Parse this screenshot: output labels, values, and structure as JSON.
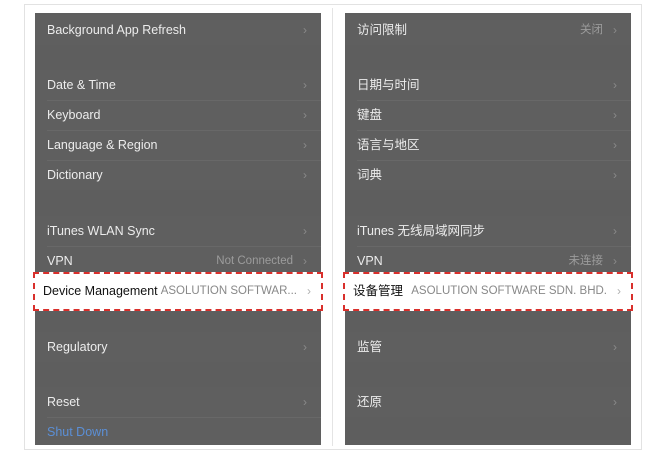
{
  "left": {
    "rows": [
      {
        "label": "Background App Refresh",
        "value": ""
      },
      {
        "label": "Date & Time",
        "value": ""
      },
      {
        "label": "Keyboard",
        "value": ""
      },
      {
        "label": "Language & Region",
        "value": ""
      },
      {
        "label": "Dictionary",
        "value": ""
      },
      {
        "label": "iTunes WLAN Sync",
        "value": ""
      },
      {
        "label": "VPN",
        "value": "Not Connected"
      },
      {
        "label": "Regulatory",
        "value": ""
      },
      {
        "label": "Reset",
        "value": ""
      },
      {
        "label": "Shut Down",
        "value": ""
      }
    ],
    "highlight": {
      "label": "Device Management",
      "value": "ASOLUTION SOFTWAR..."
    }
  },
  "right": {
    "rows": [
      {
        "label": "访问限制",
        "value": "关闭"
      },
      {
        "label": "日期与时间",
        "value": ""
      },
      {
        "label": "键盘",
        "value": ""
      },
      {
        "label": "语言与地区",
        "value": ""
      },
      {
        "label": "词典",
        "value": ""
      },
      {
        "label": "iTunes 无线局域网同步",
        "value": ""
      },
      {
        "label": "VPN",
        "value": "未连接"
      },
      {
        "label": "监管",
        "value": ""
      },
      {
        "label": "还原",
        "value": ""
      }
    ],
    "highlight": {
      "label": "设备管理",
      "value": "ASOLUTION SOFTWARE SDN. BHD."
    }
  },
  "chevron": "›",
  "colors": {
    "panel_bg": "#5e5e5e",
    "highlight_border": "#d9302c",
    "shutdown_text": "#5b8fd6"
  }
}
